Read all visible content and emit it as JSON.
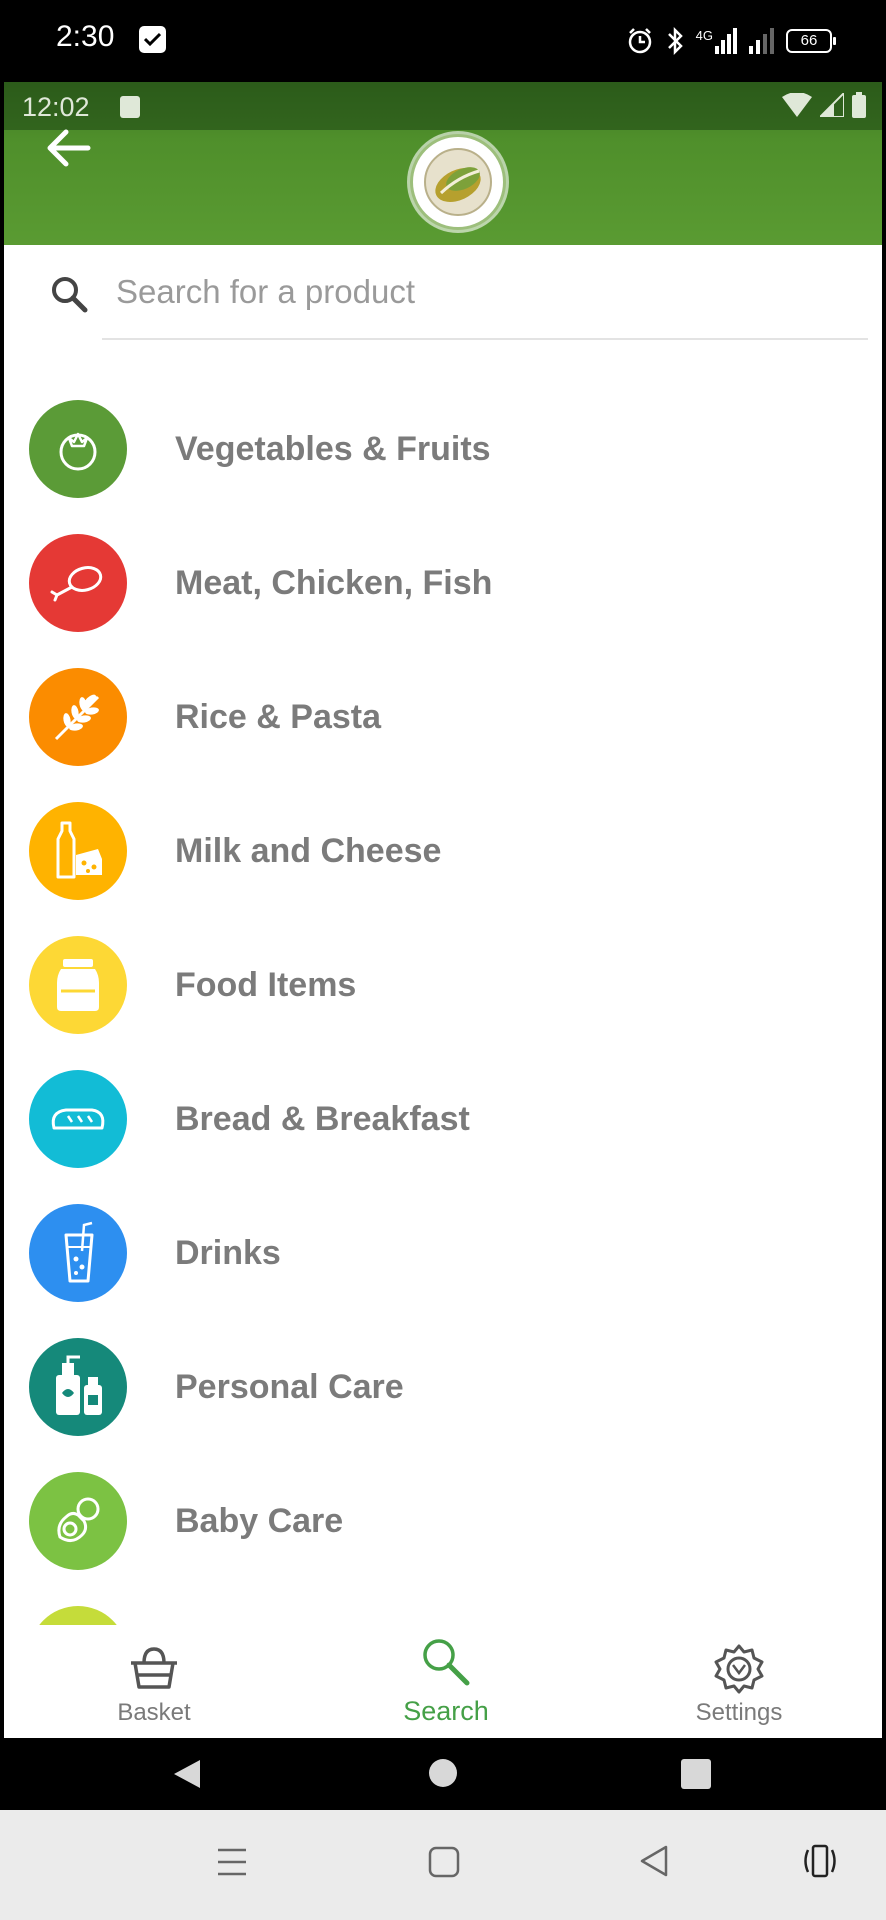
{
  "outer_status": {
    "time": "2:30",
    "battery": "66",
    "network": "4G"
  },
  "inner_status": {
    "time": "12:02"
  },
  "search": {
    "placeholder": "Search for a product"
  },
  "categories": [
    {
      "label": "Vegetables & Fruits",
      "color": "#5b9b37",
      "icon": "tomato-icon"
    },
    {
      "label": "Meat, Chicken, Fish",
      "color": "#e53935",
      "icon": "chicken-leg-icon"
    },
    {
      "label": "Rice & Pasta",
      "color": "#fb8c00",
      "icon": "wheat-icon"
    },
    {
      "label": "Milk and Cheese",
      "color": "#ffb300",
      "icon": "milk-cheese-icon"
    },
    {
      "label": "Food Items",
      "color": "#fdd835",
      "icon": "jar-icon"
    },
    {
      "label": "Bread & Breakfast",
      "color": "#12bcd6",
      "icon": "bread-icon"
    },
    {
      "label": "Drinks",
      "color": "#2d8ff0",
      "icon": "drink-glass-icon"
    },
    {
      "label": "Personal Care",
      "color": "#15897a",
      "icon": "care-bottles-icon"
    },
    {
      "label": "Baby Care",
      "color": "#7cc243",
      "icon": "pacifier-icon"
    },
    {
      "label": "",
      "color": "#c5dc3a",
      "icon": "partial-icon"
    }
  ],
  "nav": {
    "basket": "Basket",
    "search": "Search",
    "settings": "Settings",
    "active": "search",
    "active_color": "#45a047"
  },
  "theme": {
    "header_green": "#4f8f2b",
    "label_gray": "#7b7b7b"
  }
}
